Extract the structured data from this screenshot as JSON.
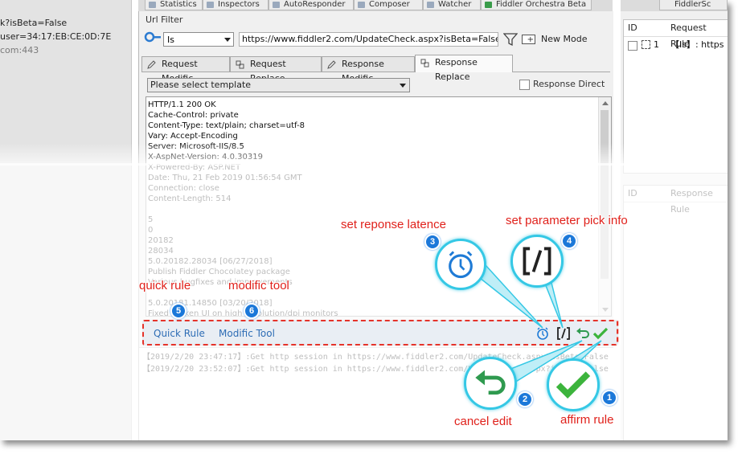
{
  "left_panel": {
    "lines": [
      "k?isBeta=False",
      "user=34:17:EB:CE:0D:7E",
      "com:443"
    ]
  },
  "top_tabs": [
    "Statistics",
    "Inspectors",
    "AutoResponder",
    "Composer",
    "Watcher",
    "Fiddler Orchestra Beta",
    "Fiddler Sc"
  ],
  "url_filter": {
    "label": "Url Filter",
    "match_type": "Is",
    "url": "https://www.fiddler2.com/UpdateCheck.aspx?isBeta=False",
    "new_mode_label": "New Mode"
  },
  "subtabs": [
    "Request Modific",
    "Request Replace",
    "Response Modific",
    "Response Replace"
  ],
  "selected_subtab": "Response Replace",
  "template": {
    "placeholder": "Please select template",
    "response_direct_label": "Response Direct"
  },
  "editor_lines": [
    "HTTP/1.1 200 OK",
    "Cache-Control: private",
    "Content-Type: text/plain; charset=utf-8",
    "Vary: Accept-Encoding",
    "Server: Microsoft-IIS/8.5",
    "X-AspNet-Version: 4.0.30319",
    "X-Powered-By: ASP.NET",
    "Date: Thu, 21 Feb 2019 01:56:54 GMT",
    "Connection: close",
    "Content-Length: 514",
    "",
    "5",
    "0",
    "20182",
    "28034",
    "5.0.20182.28034 [06/27/2018]",
    " Publish Fiddler Chocolatey package",
    " Various bugfixes and improvements",
    "",
    "5.0.20181.14850 [03/20/2018]",
    " Fixed broken UI on high resolution/dpi monitors"
  ],
  "toolbar": {
    "quick_rule": "Quick Rule",
    "modific_tool": "Modific Tool"
  },
  "log_lines": [
    "【2019/2/20 23:47:17】:Get http session in https://www.fiddler2.com/UpdateCheck.aspx?isBeta=False",
    "【2019/2/20 23:52:07】:Get http session in https://www.fiddler2.com/UpdateCheck.aspx?isBeta=False"
  ],
  "right_panel": {
    "strip_tab": "FiddlerSc",
    "table1": {
      "col_id": "ID",
      "col_rule": "Request Rule",
      "row_id": "1",
      "row_rule": "【Is】: https"
    },
    "table2": {
      "col_id": "ID",
      "col_rule": "Response Rule"
    }
  },
  "callouts": {
    "set_latency": "set reponse latence",
    "set_param": "set parameter pick info",
    "quick_rule": "quick rule",
    "modific_tool": "modific tool",
    "cancel_edit": "cancel edit",
    "affirm_rule": "affirm rule"
  },
  "badges": {
    "b1": "1",
    "b2": "2",
    "b3": "3",
    "b4": "4",
    "b5": "5",
    "b6": "6"
  },
  "colors": {
    "callout_text": "#e0211b",
    "badge": "#1b78d9",
    "bubble_ring": "#35c8e5",
    "affirm_green": "#3cb43c",
    "cancel_green": "#2f9a4f",
    "link_blue": "#2e6db5"
  }
}
